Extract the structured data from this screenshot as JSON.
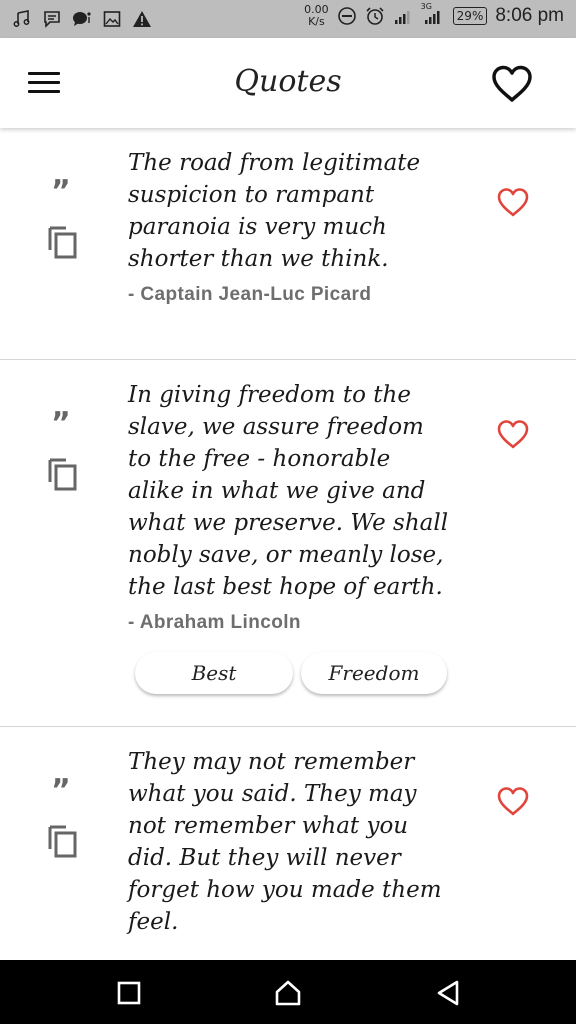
{
  "status_bar": {
    "net_speed_value": "0.00",
    "net_speed_unit": "K/s",
    "network_type": "3G",
    "battery": "29%",
    "time": "8:06 pm",
    "left_icons": [
      "music-note-icon",
      "message-icon",
      "chat-icon",
      "image-icon",
      "warning-icon"
    ],
    "right_icons": [
      "dnd-icon",
      "alarm-icon",
      "signal-icon",
      "signal-3g-icon",
      "battery-icon"
    ]
  },
  "app_bar": {
    "title": "Quotes",
    "menu_icon": "menu-icon",
    "favorites_icon": "heart-outline-icon"
  },
  "quotes": [
    {
      "lines": [
        "The road from legitimate",
        "suspicion to rampant",
        "paranoia is very much",
        "shorter than we think."
      ],
      "author": "- Captain Jean-Luc Picard",
      "tags": []
    },
    {
      "lines": [
        "In giving freedom to the",
        "slave, we assure freedom",
        "to the free - honorable",
        "alike in what we give and",
        "what we preserve. We shall",
        "nobly save, or meanly lose,",
        "the last best hope of earth."
      ],
      "author": "- Abraham Lincoln",
      "tags": [
        "Best",
        "Freedom"
      ]
    },
    {
      "lines": [
        "They may not remember",
        "what you said. They may",
        "not remember what you",
        "did. But they will never",
        "forget how you made them",
        "feel."
      ],
      "author": "",
      "tags": []
    }
  ],
  "colors": {
    "heart": "#e0463c",
    "status_bar_bg": "#bdbdbd",
    "nav_bar_bg": "#000000",
    "author_text": "#6e6e6e"
  },
  "nav_bar": {
    "buttons": [
      "recent-apps-icon",
      "home-icon",
      "back-icon"
    ]
  }
}
